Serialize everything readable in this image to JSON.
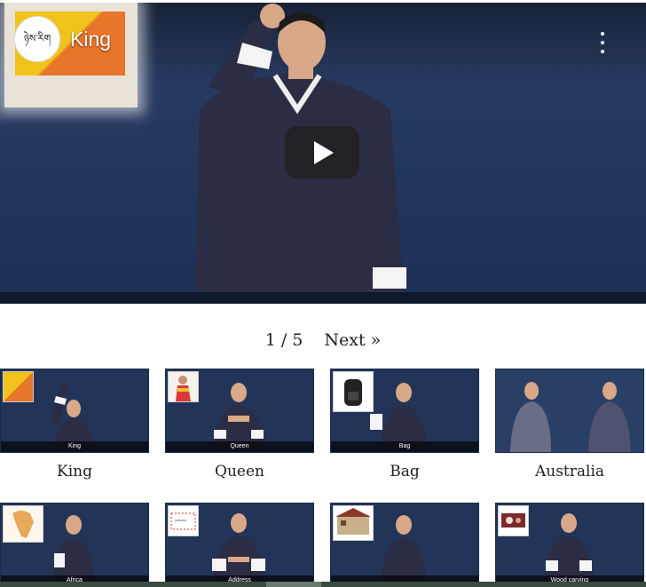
{
  "video": {
    "title": "King",
    "channel_logo_text": "ཉེས་རིག",
    "icons": {
      "menu": "more-vert-icon",
      "play": "play-icon"
    }
  },
  "pagination": {
    "page_count": "1 / 5",
    "next_label": "Next »"
  },
  "videos": [
    {
      "label": "King",
      "caption": "King",
      "inset": "flag-image"
    },
    {
      "label": "Queen",
      "caption": "Queen",
      "inset": "queen-image"
    },
    {
      "label": "Bag",
      "caption": "Bag",
      "inset": "backpack-image"
    },
    {
      "label": "Australia",
      "caption": "",
      "inset": ""
    },
    {
      "label": "",
      "caption": "Africa",
      "inset": "africa-map-image"
    },
    {
      "label": "",
      "caption": "Address",
      "inset": "envelope-image"
    },
    {
      "label": "",
      "caption": "",
      "inset": "building-image"
    },
    {
      "label": "",
      "caption": "Wood carving",
      "inset": "carving-image"
    }
  ],
  "colors": {
    "player_bg": "#22365c",
    "gho_robe": "#2b2d45",
    "cuff": "#ffffff"
  }
}
